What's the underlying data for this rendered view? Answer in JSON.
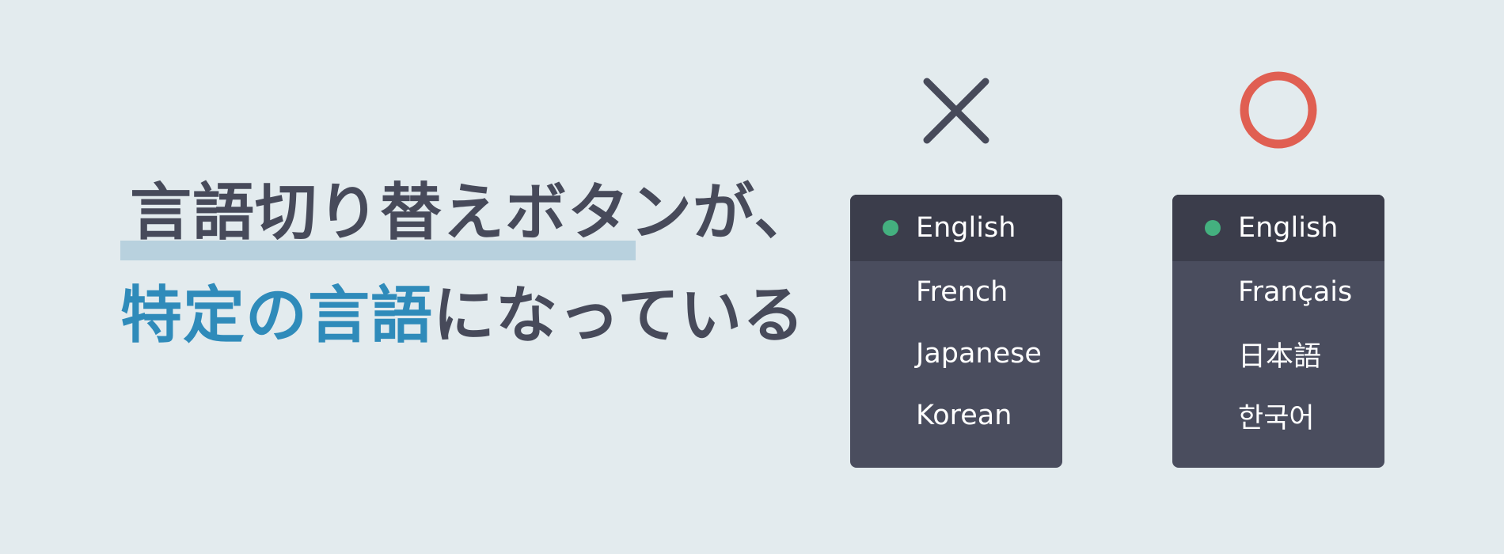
{
  "headline": {
    "line1": "言語切り替えボタンが、",
    "line2_accent_1": "特定",
    "line2_accent_2": "の",
    "line2_accent_3": "言語",
    "line2_rest": "になっている"
  },
  "comparison": {
    "bad": {
      "mark": "x-icon",
      "items": [
        {
          "label": "English",
          "selected": true
        },
        {
          "label": "French",
          "selected": false
        },
        {
          "label": "Japanese",
          "selected": false
        },
        {
          "label": "Korean",
          "selected": false
        }
      ]
    },
    "good": {
      "mark": "circle-icon",
      "items": [
        {
          "label": "English",
          "selected": true
        },
        {
          "label": "Français",
          "selected": false
        },
        {
          "label": "日本語",
          "selected": false
        },
        {
          "label": "한국어",
          "selected": false
        }
      ]
    }
  },
  "colors": {
    "background": "#e3ebee",
    "text": "#474a5a",
    "accent": "#2f8bba",
    "highlight": "#b8d1de",
    "good_mark": "#e05f52",
    "menu_bg": "#4a4d5e",
    "menu_active_bg": "#3b3d4b",
    "selected_dot": "#44b07f"
  }
}
